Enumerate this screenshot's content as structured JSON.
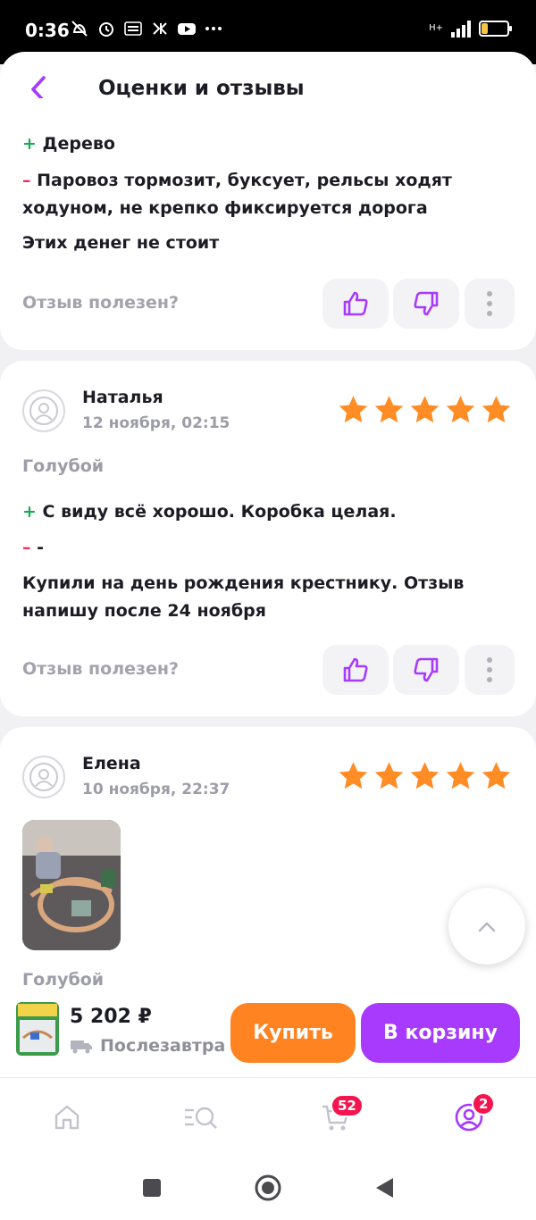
{
  "status_bar": {
    "time": "0:36",
    "network": "H+",
    "battery": "24",
    "battery_level_fraction": 0.24
  },
  "header": {
    "title": "Оценки и отзывы"
  },
  "review_partial": {
    "plus_sign": "+",
    "plus_text": "Дерево",
    "minus_sign": "–",
    "minus_text_line1": "Паровоз тормозит, буксует, рельсы ходят",
    "minus_text_line2": "ходуном, не крепко фиксируется дорога",
    "comment": "Этих денег не стоит",
    "helpful_label": "Отзыв полезен?"
  },
  "review_natalya": {
    "author": "Наталья",
    "date": "12 ноября, 02:15",
    "rating": 5,
    "variant": "Голубой",
    "plus_sign": "+",
    "plus_text": "С виду всё хорошо. Коробка целая.",
    "minus_sign": "–",
    "minus_text": "-",
    "comment_line1": "Купили на день рождения крестнику. Отзыв",
    "comment_line2": "напишу после 24 ноября",
    "helpful_label": "Отзыв полезен?"
  },
  "review_elena": {
    "author": "Елена",
    "date": "10 ноября, 22:37",
    "rating": 5,
    "variant": "Голубой"
  },
  "buy_bar": {
    "price": "5 202 ₽",
    "delivery": "Послезавтра",
    "buy_label": "Купить",
    "cart_label": "В корзину"
  },
  "bottom_nav": {
    "cart_badge": "52",
    "profile_badge": "2"
  },
  "colors": {
    "accent": "#a73afd",
    "buy": "#ff8320",
    "star": "#ff8c24",
    "plus": "#1ea856",
    "minus": "#e8335a",
    "badge": "#f4154f"
  }
}
